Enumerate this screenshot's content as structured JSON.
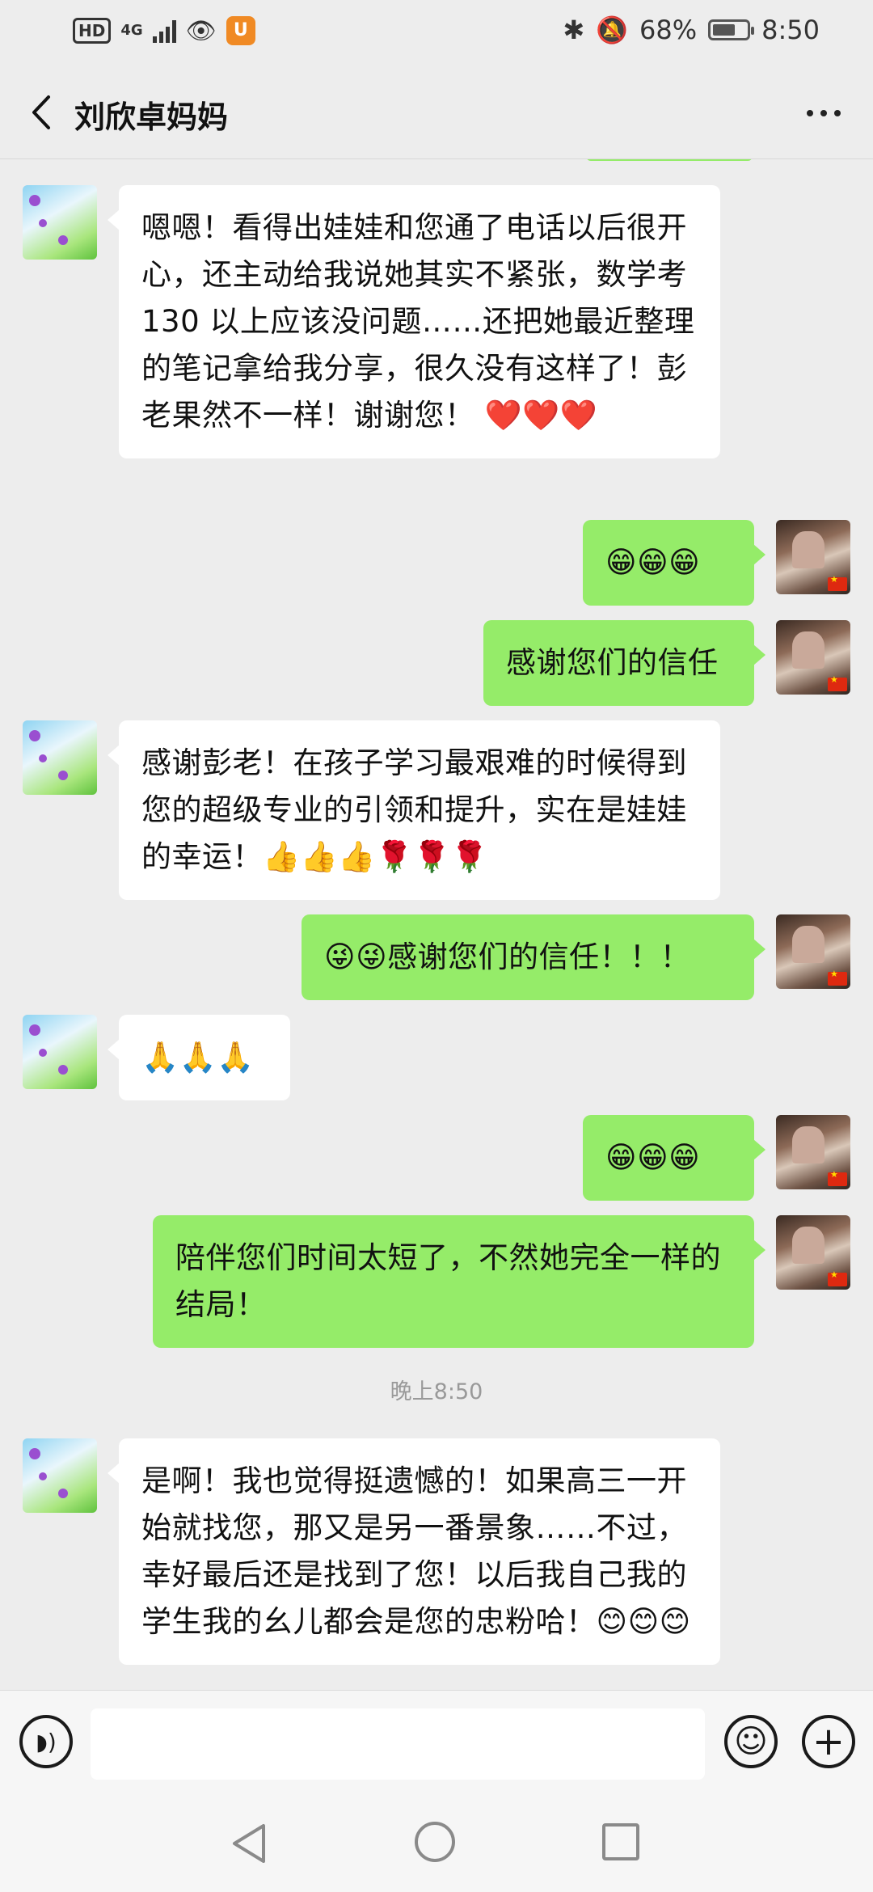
{
  "status_bar": {
    "hd": "HD",
    "network": "4G",
    "battery": "68%",
    "battery_level": 0.68,
    "time": "8:50",
    "icons": [
      "signal-icon",
      "eye-icon",
      "uc-browser-icon",
      "bluetooth-icon",
      "mute-icon",
      "battery-icon"
    ]
  },
  "header": {
    "title": "刘欣卓妈妈",
    "back_icon": "chevron-left-icon",
    "more_icon": "more-icon"
  },
  "messages": [
    {
      "side": "in",
      "text": "嗯嗯！看得出娃娃和您通了电话以后很开心，还主动给我说她其实不紧张，数学考 130 以上应该没问题……还把她最近整理的笔记拿给我分享，很久没有这样了！彭老果然不一样！谢谢您！ ❤️❤️❤️"
    },
    {
      "side": "out",
      "text": "😁😁😁"
    },
    {
      "side": "out",
      "text": "感谢您们的信任"
    },
    {
      "side": "in",
      "text": "感谢彭老！在孩子学习最艰难的时候得到您的超级专业的引领和提升，实在是娃娃的幸运！👍👍👍🌹🌹🌹"
    },
    {
      "side": "out",
      "text": "😜😜感谢您们的信任！！！"
    },
    {
      "side": "in",
      "text": "🙏🙏🙏"
    },
    {
      "side": "out",
      "text": "😁😁😁"
    },
    {
      "side": "out",
      "text": "陪伴您们时间太短了，不然她完全一样的结局！"
    },
    {
      "side": "time",
      "text": "晚上8:50"
    },
    {
      "side": "in",
      "text": "是啊！我也觉得挺遗憾的！如果高三一开始就找您，那又是另一番景象……不过，幸好最后还是找到了您！以后我自己我的学生我的幺儿都会是您的忠粉哈！😊😊😊"
    }
  ],
  "input_bar": {
    "voice_icon": "voice-icon",
    "emoji_icon": "emoji-icon",
    "plus_icon": "plus-icon",
    "placeholder": ""
  },
  "nav_bar": {
    "icons": [
      "nav-back-icon",
      "nav-home-icon",
      "nav-recent-icon"
    ]
  }
}
